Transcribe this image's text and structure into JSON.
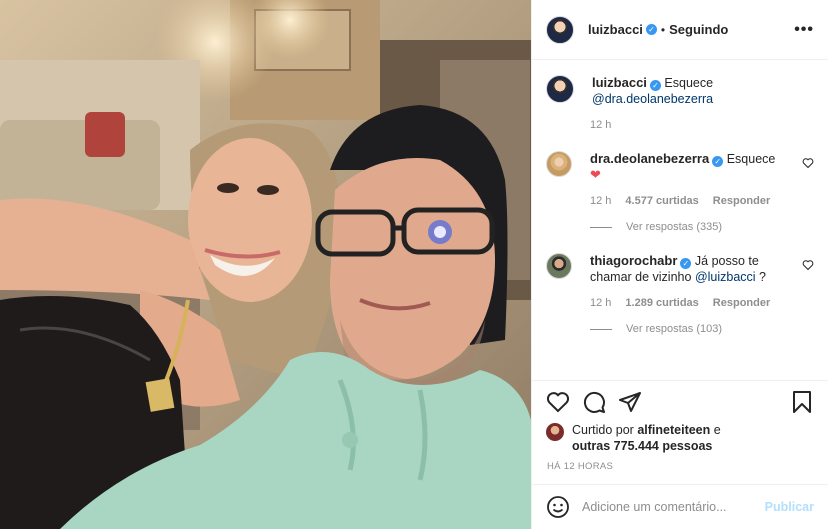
{
  "header": {
    "username": "luizbacci",
    "separator": "•",
    "follow_status": "Seguindo",
    "more_icon": "more-options-icon"
  },
  "caption": {
    "username": "luizbacci",
    "text": "Esquece",
    "mention": "@dra.deolanebezerra",
    "time": "12 h"
  },
  "comments": [
    {
      "username": "dra.deolanebezerra",
      "text": "Esquece",
      "emoji": "❤",
      "time": "12 h",
      "likes": "4.577 curtidas",
      "reply": "Responder",
      "view_replies": "Ver respostas (335)"
    },
    {
      "username": "thiagorochabr",
      "text": "Já posso te chamar de vizinho",
      "mention": "@luizbacci",
      "suffix": " ?",
      "time": "12 h",
      "likes": "1.289 curtidas",
      "reply": "Responder",
      "view_replies": "Ver respostas (103)"
    }
  ],
  "likes": {
    "prefix": "Curtido por",
    "user": "alfineteiteen",
    "middle": "e",
    "others": "outras 775.444 pessoas"
  },
  "post_time": "HÁ 12 HORAS",
  "add_comment": {
    "placeholder": "Adicione um comentário...",
    "publish_label": "Publicar"
  },
  "icons": [
    "heart-icon",
    "comment-icon",
    "share-icon",
    "bookmark-icon",
    "emoji-icon"
  ],
  "colors": {
    "link": "#00376b",
    "muted": "#8e8e8e",
    "verified": "#3897f0",
    "publish_disabled": "#b2dffc",
    "like_red": "#ed4956"
  }
}
